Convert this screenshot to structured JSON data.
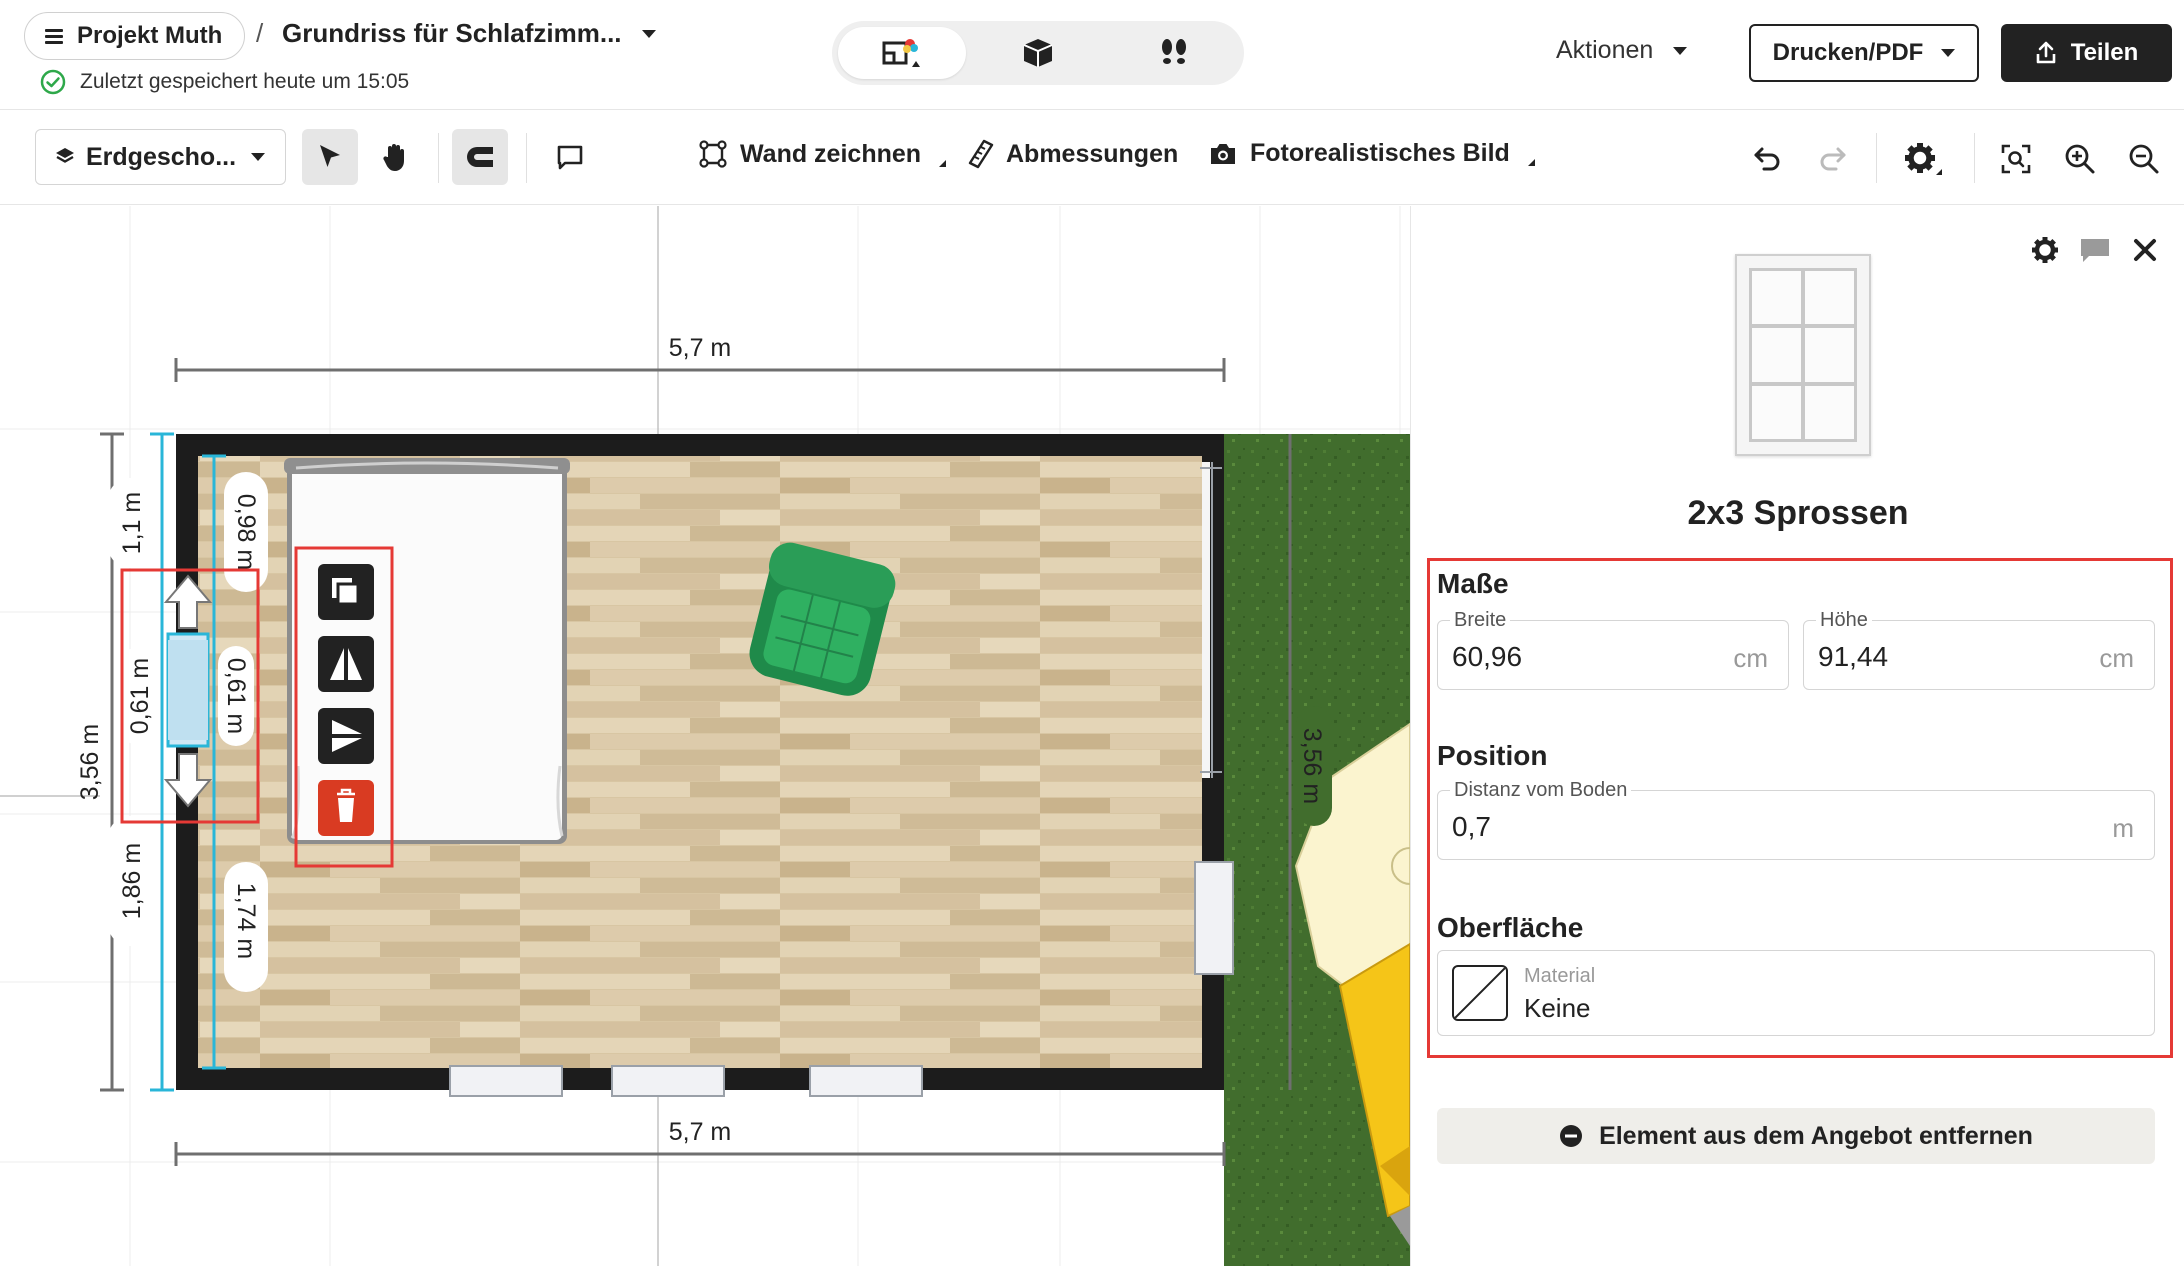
{
  "header": {
    "project_label": "Projekt Muth",
    "separator": "/",
    "document_title": "Grundriss für Schlafzimm...",
    "saved_status": "Zuletzt gespeichert heute um 15:05",
    "actions_label": "Aktionen",
    "print_label": "Drucken/PDF",
    "share_label": "Teilen",
    "view_modes": [
      "2d-plan-icon",
      "3d-box-icon",
      "walkthrough-icon"
    ],
    "active_view": "2d-plan-icon"
  },
  "toolbar": {
    "floor_label": "Erdgescho...",
    "draw_wall_label": "Wand zeichnen",
    "dimensions_label": "Abmessungen",
    "photo_label": "Fotorealistisches Bild"
  },
  "canvas": {
    "dim_top": "5,7 m",
    "dim_bottom": "5,7 m",
    "dim_left_total": "3,56 m",
    "dim_left_top": "1,1 m",
    "dim_left_mid": "0,61 m",
    "dim_left_bottom": "1,86 m",
    "dim_inner_top": "0,98 m",
    "dim_inner_mid": "0,61 m",
    "dim_inner_bottom": "1,74 m",
    "dim_right_wall": "3,56 m"
  },
  "panel": {
    "element_title": "2x3 Sprossen",
    "section_dimensions": "Maße",
    "width_label": "Breite",
    "width_value": "60,96",
    "width_unit": "cm",
    "height_label": "Höhe",
    "height_value": "91,44",
    "height_unit": "cm",
    "section_position": "Position",
    "floor_distance_label": "Distanz vom Boden",
    "floor_distance_value": "0,7",
    "floor_distance_unit": "m",
    "section_surface": "Oberfläche",
    "material_label": "Material",
    "material_value": "Keine",
    "remove_label": "Element aus dem Angebot entfernen"
  },
  "colors": {
    "accent_blue": "#29b6d8",
    "highlight_red": "#e53935",
    "delete_red": "#d93b22",
    "wall": "#1c1c1c",
    "grass": "#3f6b2b",
    "floor_wood": "#d6c3a0"
  }
}
